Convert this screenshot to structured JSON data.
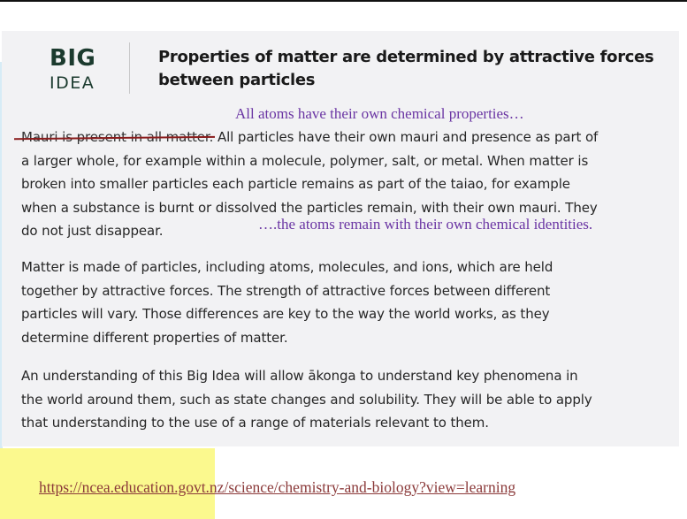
{
  "big_idea": {
    "big": "BIG",
    "idea": "IDEA"
  },
  "heading": "Properties of matter are determined by attractive forces between particles",
  "heading_line1": "Properties of matter are determined by attractive forces",
  "heading_line2": "between particles",
  "annotations": {
    "top": "All atoms have their own chemical properties…",
    "mid": "….the atoms remain with their own chemical identities."
  },
  "paragraph1": {
    "struck_text": "Mauri is present in all matter.",
    "line1_rest": " All particles have their own mauri and presence as part of",
    "line2": "a larger whole, for example within a molecule, polymer, salt, or metal. When matter is",
    "line3": "broken into smaller particles each particle remains as part of the taiao, for example",
    "line4": "when a substance is burnt or dissolved the particles remain, with their own mauri. They",
    "line5": "do not just disappear."
  },
  "paragraph2": {
    "line1": "Matter is made of particles, including atoms, molecules, and ions, which are held",
    "line2": "together by attractive forces. The strength of attractive forces between different",
    "line3": "particles will vary. Those differences are key to the way the world works, as they",
    "line4": "determine different properties of matter."
  },
  "paragraph3": {
    "line1": "An understanding of this Big Idea will allow ākonga to understand key phenomena in",
    "line2": "the world around them, such as state changes and solubility. They will be able to apply",
    "line3": "that understanding to the use of a range of materials relevant to them."
  },
  "link": {
    "url_text": "https://ncea.education.govt.nz/science/chemistry-and-biology?view=learning"
  },
  "colors": {
    "annotation": "#6a35a3",
    "strike": "#8a1d1d",
    "highlight": "#fbf98e",
    "link": "#8b3a3a",
    "big_idea": "#1b3a2e"
  }
}
